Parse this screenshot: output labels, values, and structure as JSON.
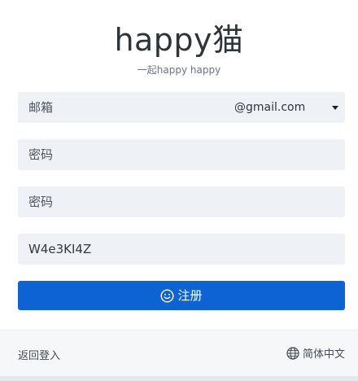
{
  "header": {
    "title": "happy猫",
    "subtitle": "一起happy happy"
  },
  "form": {
    "email_placeholder": "邮箱",
    "email_domain": "@gmail.com",
    "password_placeholder": "密码",
    "confirm_password_placeholder": "密码",
    "captcha_value": "W4e3KI4Z",
    "submit_label": "注册",
    "submit_icon": "smile-icon"
  },
  "footer": {
    "back_label": "返回登入",
    "language_label": "简体中文",
    "language_icon": "globe-icon"
  },
  "colors": {
    "accent": "#0e63d3",
    "field_bg": "#eef1f6",
    "footer_bg": "#f6f7f9"
  }
}
